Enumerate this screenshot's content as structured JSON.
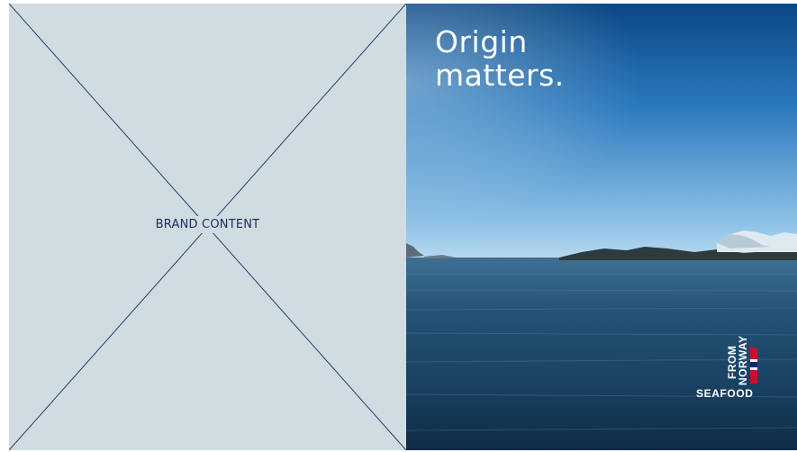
{
  "left_panel": {
    "placeholder_label": "BRAND CONTENT"
  },
  "right_panel": {
    "headline_line1": "Origin",
    "headline_line2": "matters."
  },
  "logo": {
    "seafood": "SEAFOOD",
    "from": "FROM",
    "norway": "NORWAY"
  },
  "colors": {
    "placeholder_bg": "#cfdce2",
    "line_color": "#2b3a6e",
    "flag_red": "#c8102e",
    "flag_blue": "#002868",
    "flag_white": "#ffffff"
  }
}
